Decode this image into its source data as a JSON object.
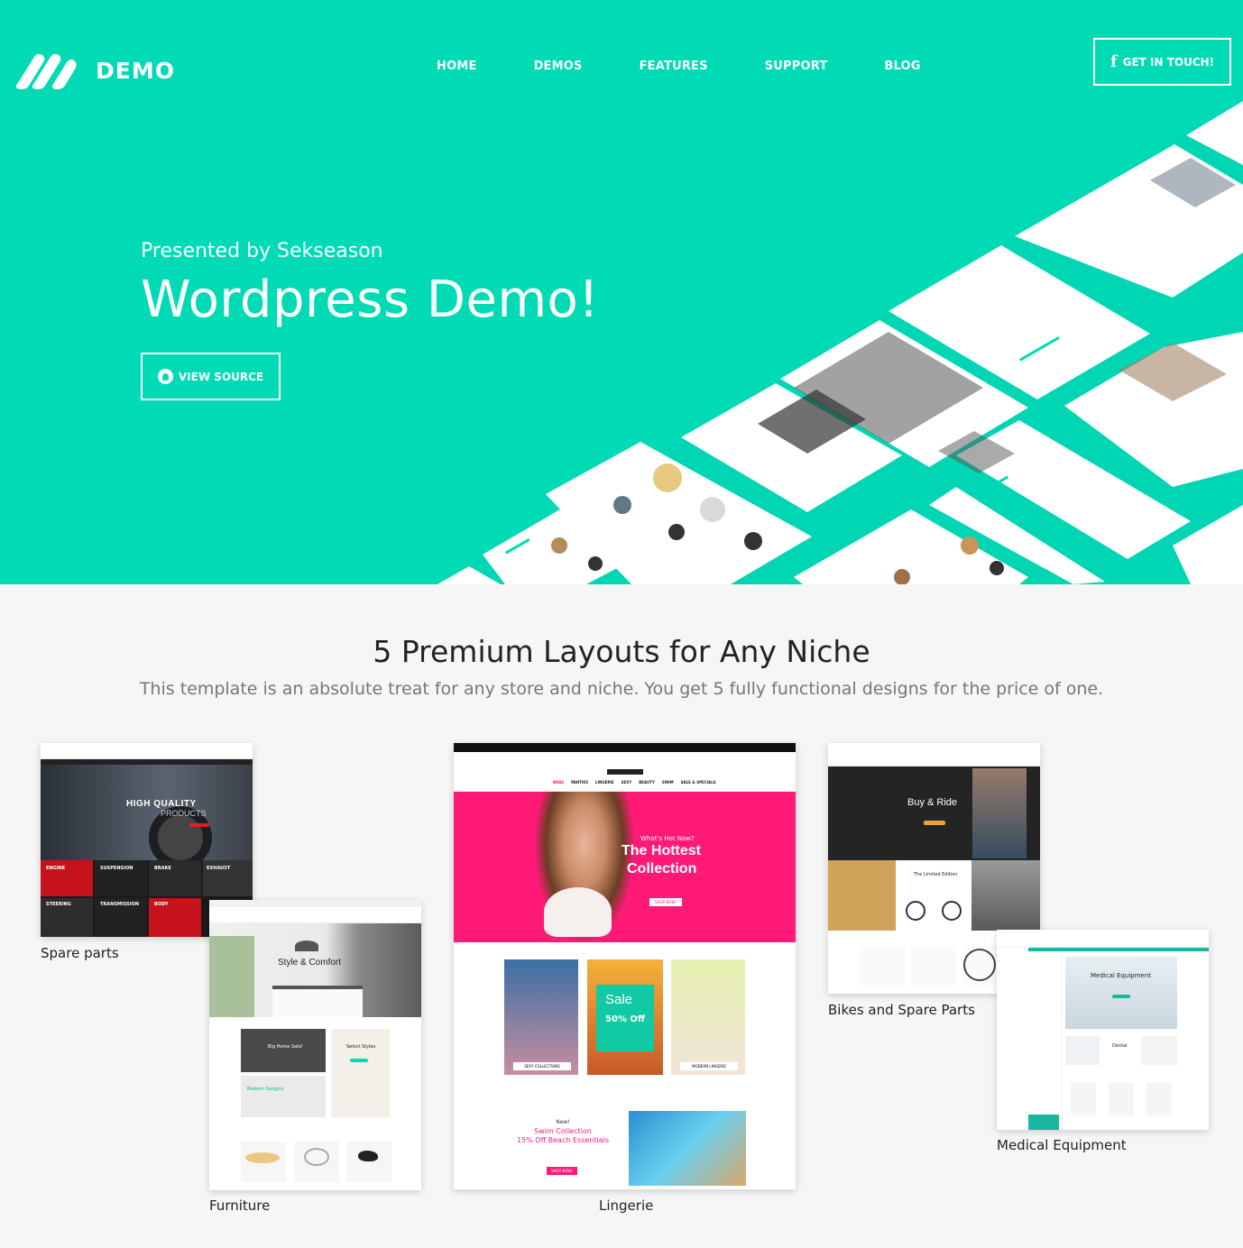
{
  "brand": {
    "logo_text": "DEMO"
  },
  "nav": [
    {
      "label": "HOME"
    },
    {
      "label": "DEMOS"
    },
    {
      "label": "FEATURES"
    },
    {
      "label": "SUPPORT"
    },
    {
      "label": "BLOG"
    }
  ],
  "header_cta": {
    "icon": "facebook-icon",
    "label": "GET IN TOUCH!"
  },
  "hero": {
    "presented": "Presented by Sekseason",
    "title": "Wordpress Demo!",
    "button": {
      "icon": "github-icon",
      "label": "VIEW SOURCE"
    }
  },
  "section": {
    "title": "5 Premium Layouts for Any Niche",
    "subtitle": "This template is an absolute treat for any store and niche. You get 5 fully functional designs for the price of one."
  },
  "layouts": [
    {
      "caption": "Spare parts",
      "banner_title": "HIGH QUALITY",
      "banner_sub": "PRODUCTS",
      "tiles": [
        "ENGINE",
        "SUSPENSION",
        "BRAKE",
        "EXHAUST",
        "STEERING",
        "TRANSMISSION",
        "BODY"
      ]
    },
    {
      "caption": "Furniture",
      "banner_title": "Style & Comfort",
      "promo_1": "Big Home Sale!",
      "promo_2": "Select Styles",
      "promo_3": "Modern Designs"
    },
    {
      "caption": "Lingerie",
      "menu": [
        "BRAS",
        "PANTIES",
        "LINGERIE",
        "SEXY",
        "BEAUTY",
        "SWIM",
        "SALE & SPECIALS"
      ],
      "banner_kicker": "What's Hot Now?",
      "banner_title_1": "The Hottest",
      "banner_title_2": "Collection",
      "banner_button": "SHOP NOW!",
      "tile_1": "SEXY COLLECTIONS",
      "sale_title": "Sale",
      "sale_off": "50% Off",
      "tile_3": "MODERN LINGERIE",
      "promo_kicker": "New!",
      "promo_title_1": "Swim Collection",
      "promo_title_2": "15% Off Beach Essentials",
      "promo_button": "SHOP NOW!"
    },
    {
      "caption": "Bikes and Spare Parts",
      "banner_title": "Buy & Ride",
      "promo": "The Limited Edition"
    },
    {
      "caption": "Medical Equipment",
      "banner_title": "Medical Equipment",
      "promo": "Dental"
    }
  ],
  "colors": {
    "accent": "#00dbb5",
    "pink": "#ff1a78",
    "dark": "#1e1e1e"
  }
}
